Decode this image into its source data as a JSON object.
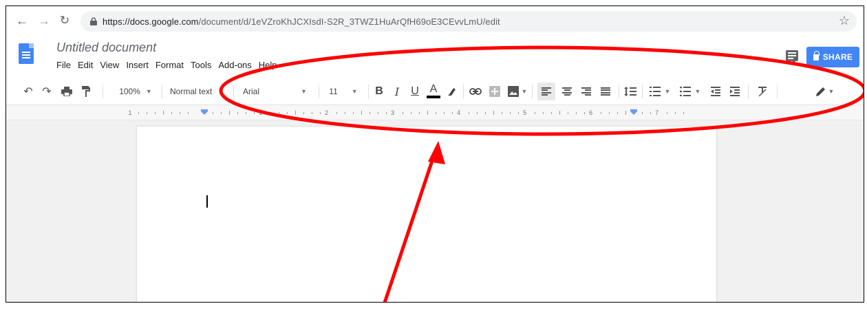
{
  "browser": {
    "back_icon": "arrow-left-icon",
    "forward_icon": "arrow-right-icon",
    "reload_icon": "reload-icon",
    "url_host": "https://docs.google.com",
    "url_path": "/document/d/1eVZroKhJCXIsdI-S2R_3TWZ1HuArQfH69oE3CEvvLmU/edit",
    "bookmark_icon": "star-icon"
  },
  "doc": {
    "title": "Untitled document",
    "menu": [
      "File",
      "Edit",
      "View",
      "Insert",
      "Format",
      "Tools",
      "Add-ons",
      "Help"
    ],
    "share_label": "SHARE"
  },
  "toolbar": {
    "zoom": "100%",
    "style": "Normal text",
    "font": "Arial",
    "size": "11",
    "bold": "B",
    "italic": "I",
    "underline": "U",
    "text_color": "A",
    "text_color_value": "#000000"
  },
  "ruler": {
    "numbers": [
      "1",
      "1",
      "2",
      "3",
      "4",
      "5",
      "6",
      "7"
    ]
  },
  "colors": {
    "accent": "#4285f4",
    "annotation": "#ff0000"
  }
}
